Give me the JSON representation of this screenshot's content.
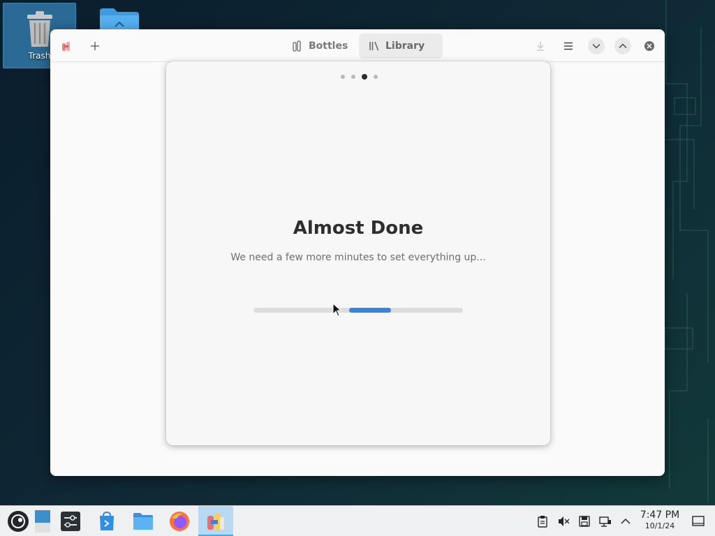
{
  "desktop": {
    "icons": [
      {
        "label": "Trash",
        "icon": "trash-icon"
      },
      {
        "label": "",
        "icon": "folder-icon"
      }
    ]
  },
  "window": {
    "app_icon": "bottles-logo-icon",
    "tabs": [
      {
        "label": "Bottles",
        "icon": "bottles-tab-icon",
        "active": false
      },
      {
        "label": "Library",
        "icon": "library-tab-icon",
        "active": true
      }
    ],
    "controls": [
      "add-icon",
      "download-icon",
      "menu-icon",
      "minimize-icon",
      "maximize-icon",
      "close-icon"
    ]
  },
  "onboarding": {
    "step_total": 4,
    "step_current": 3,
    "title": "Almost Done",
    "subtitle": "We need a few more minutes to set everything up...",
    "progress": "indeterminate",
    "accent_color": "#3584e4"
  },
  "taskbar": {
    "apps": [
      "start-menu-icon",
      "show-desktop-icon",
      "system-settings-icon",
      "discover-icon",
      "file-manager-icon",
      "firefox-icon",
      "bottles-icon"
    ],
    "active_app": "bottles-icon",
    "tray": [
      "clipboard-icon",
      "volume-muted-icon",
      "save-icon",
      "network-icon",
      "expand-tray-icon"
    ],
    "time": "7:47 PM",
    "date": "10/1/24",
    "highlight_color": "#3daee9"
  }
}
